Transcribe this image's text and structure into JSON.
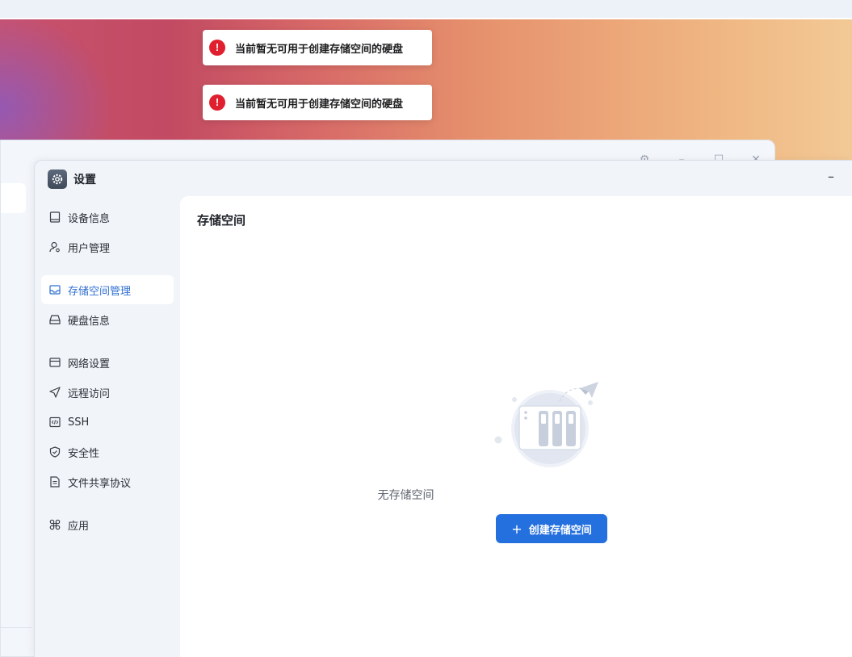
{
  "toasts": [
    {
      "icon": "error-icon",
      "text": "当前暂无可用于创建存储空间的硬盘"
    },
    {
      "icon": "error-icon",
      "text": "当前暂无可用于创建存储空间的硬盘"
    }
  ],
  "background_window": {
    "controls": {
      "settings": "⚙",
      "minimize": "–",
      "maximize": "☐",
      "close": "✕"
    }
  },
  "settings_window": {
    "title": "设置",
    "minimize": "–",
    "sidebar": {
      "items": [
        {
          "label": "设备信息",
          "icon": "device-info-icon"
        },
        {
          "label": "用户管理",
          "icon": "user-manage-icon"
        },
        {
          "label": "存储空间管理",
          "icon": "storage-manage-icon",
          "active": true
        },
        {
          "label": "硬盘信息",
          "icon": "disk-icon"
        },
        {
          "label": "网络设置",
          "icon": "network-icon"
        },
        {
          "label": "远程访问",
          "icon": "remote-access-icon"
        },
        {
          "label": "SSH",
          "icon": "ssh-icon"
        },
        {
          "label": "安全性",
          "icon": "shield-icon"
        },
        {
          "label": "文件共享协议",
          "icon": "file-share-icon"
        },
        {
          "label": "应用",
          "icon": "apps-icon"
        }
      ]
    },
    "content": {
      "title": "存储空间",
      "empty_text": "无存储空间",
      "create_button": {
        "plus": "+",
        "label": "创建存储空间"
      }
    }
  },
  "colors": {
    "accent": "#2470de",
    "error": "#e0202e",
    "active_nav_text": "#2f6fd0"
  }
}
